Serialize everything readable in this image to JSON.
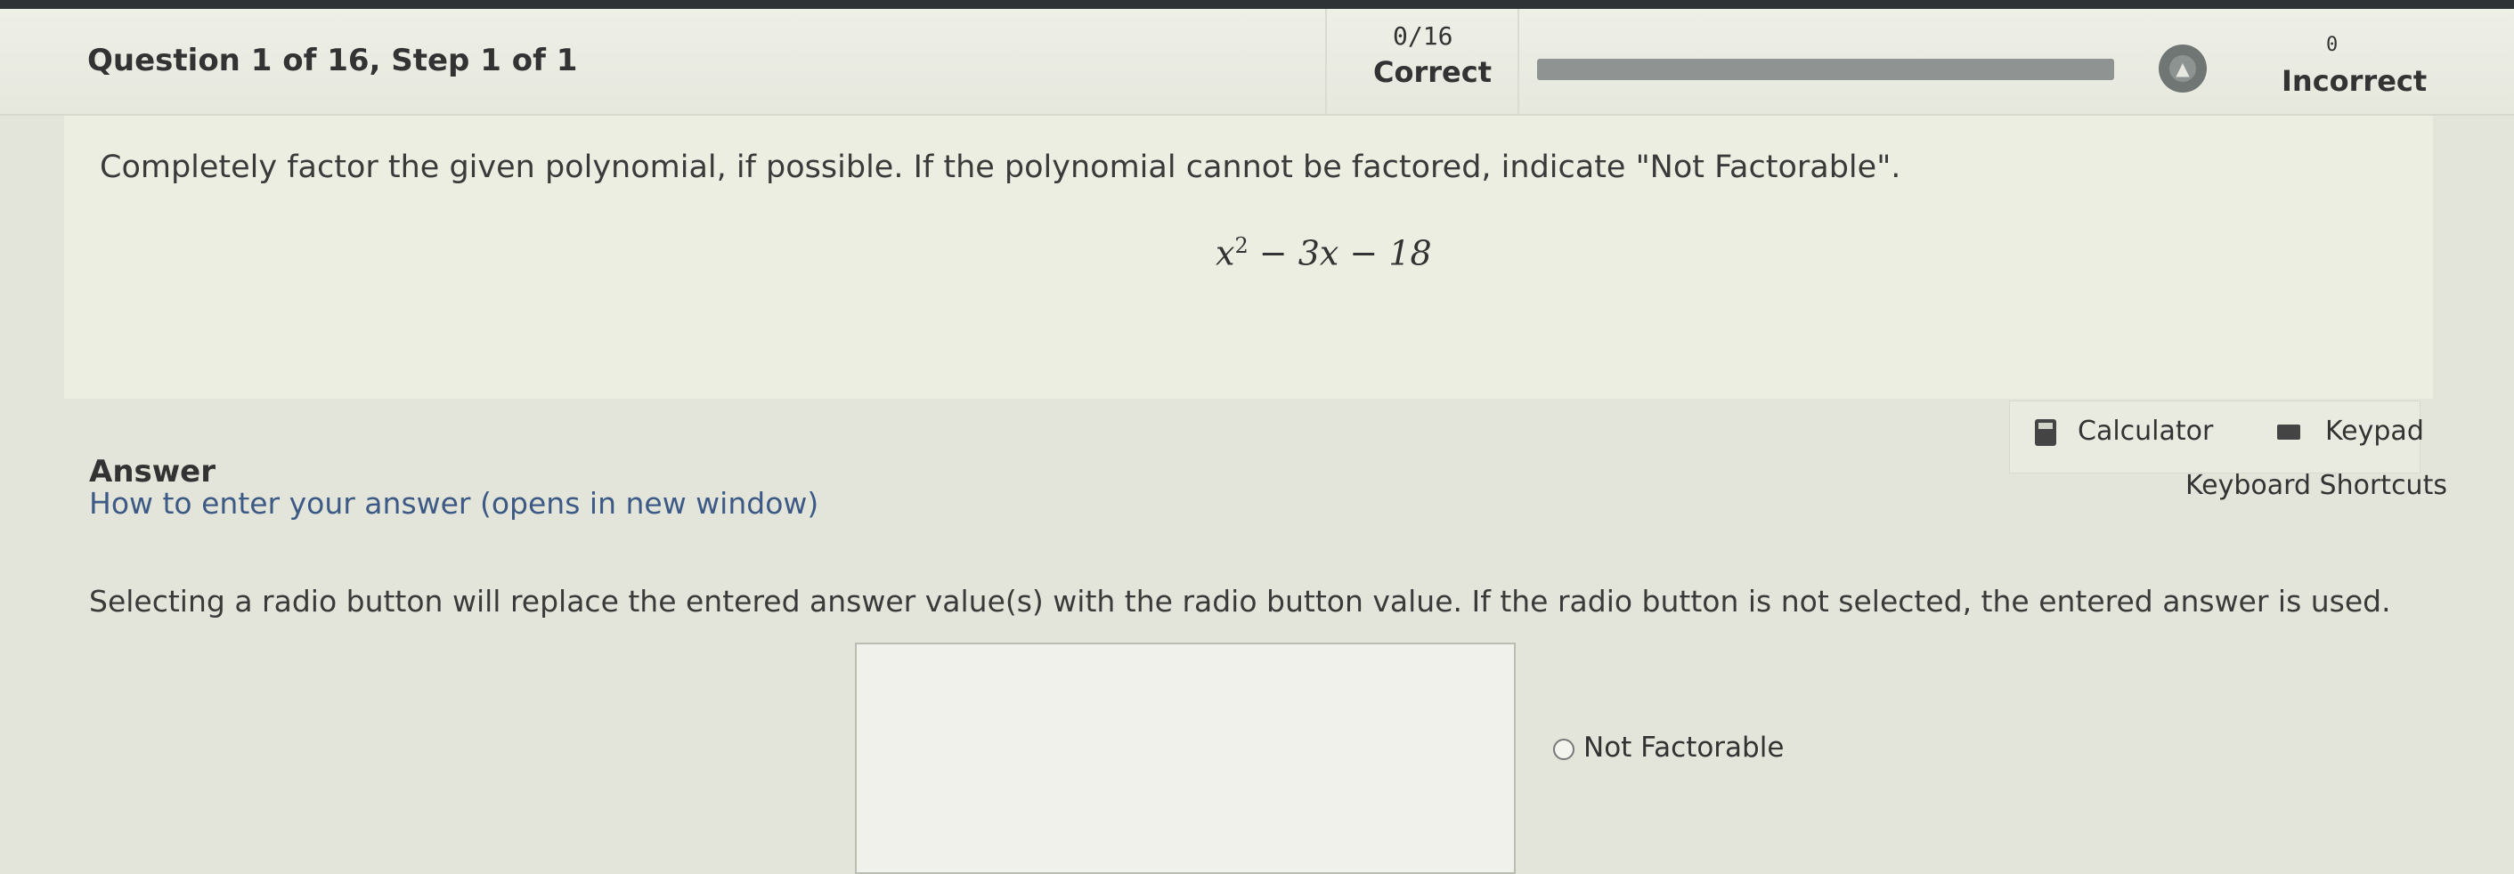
{
  "header": {
    "question_title": "Question 1 of 16,  Step 1 of 1",
    "score": "0/16",
    "correct_label": "Correct",
    "incorrect_count": "0",
    "incorrect_label": "Incorrect",
    "progress_fraction": 0
  },
  "question": {
    "prompt": "Completely factor the given polynomial, if possible. If the polynomial cannot be factored, indicate \"Not Factorable\".",
    "polynomial": {
      "base": "x",
      "exponent": "2",
      "rest": " − 3x − 18"
    }
  },
  "answer": {
    "heading": "Answer",
    "how_to_link": "How to enter your answer (opens in new window)",
    "calculator_label": "Calculator",
    "keypad_label": "Keypad",
    "shortcuts_label": "Keyboard Shortcuts",
    "radio_note": "Selecting a radio button will replace the entered answer value(s) with the radio button value. If the radio button is not selected, the entered answer is used.",
    "input_value": "",
    "radio_option": "Not Factorable"
  },
  "icons": {
    "calculator": "calculator-icon",
    "keypad": "keypad-icon",
    "pie": "progress-pie-icon"
  },
  "colors": {
    "background": "#e3e5da",
    "link": "#3d5a86",
    "topbar": "#2e3336"
  }
}
